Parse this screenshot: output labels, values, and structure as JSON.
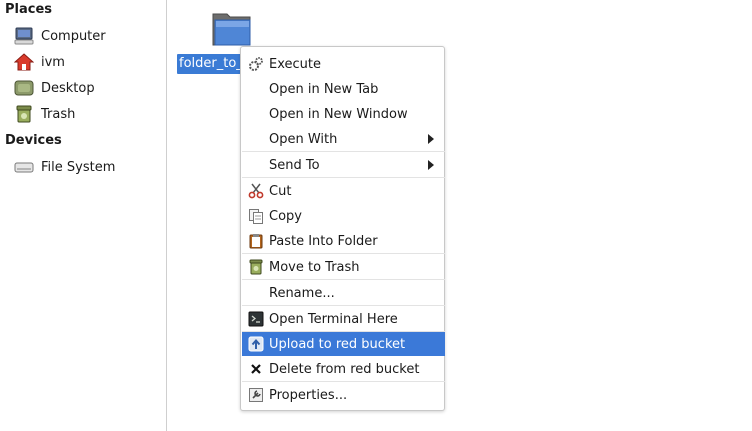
{
  "sidebar": {
    "places_title": "Places",
    "places": [
      {
        "label": "Computer",
        "icon": "computer-icon"
      },
      {
        "label": "ivm",
        "icon": "home-icon"
      },
      {
        "label": "Desktop",
        "icon": "desktop-icon"
      },
      {
        "label": "Trash",
        "icon": "trash-icon"
      }
    ],
    "devices_title": "Devices",
    "devices": [
      {
        "label": "File System",
        "icon": "drive-icon"
      }
    ]
  },
  "content": {
    "folder": {
      "label": "folder_to_",
      "icon": "folder-icon"
    }
  },
  "context_menu": {
    "items": [
      {
        "label": "Execute",
        "icon": "gears-icon"
      },
      {
        "label": "Open in New Tab"
      },
      {
        "label": "Open in New Window"
      },
      {
        "label": "Open With",
        "submenu": true
      },
      {
        "label": "Send To",
        "submenu": true
      },
      {
        "label": "Cut",
        "icon": "scissors-icon"
      },
      {
        "label": "Copy",
        "icon": "copy-icon"
      },
      {
        "label": "Paste Into Folder",
        "icon": "clipboard-icon"
      },
      {
        "label": "Move to Trash",
        "icon": "trash-icon"
      },
      {
        "label": "Rename..."
      },
      {
        "label": "Open Terminal Here",
        "icon": "terminal-icon"
      },
      {
        "label": "Upload to red bucket",
        "icon": "upload-icon",
        "highlighted": true
      },
      {
        "label": "Delete from red bucket",
        "icon": "x-icon"
      },
      {
        "label": "Properties...",
        "icon": "properties-icon"
      }
    ]
  },
  "colors": {
    "selection": "#3b79d8",
    "folder_label_bg": "#3a7bd5"
  }
}
